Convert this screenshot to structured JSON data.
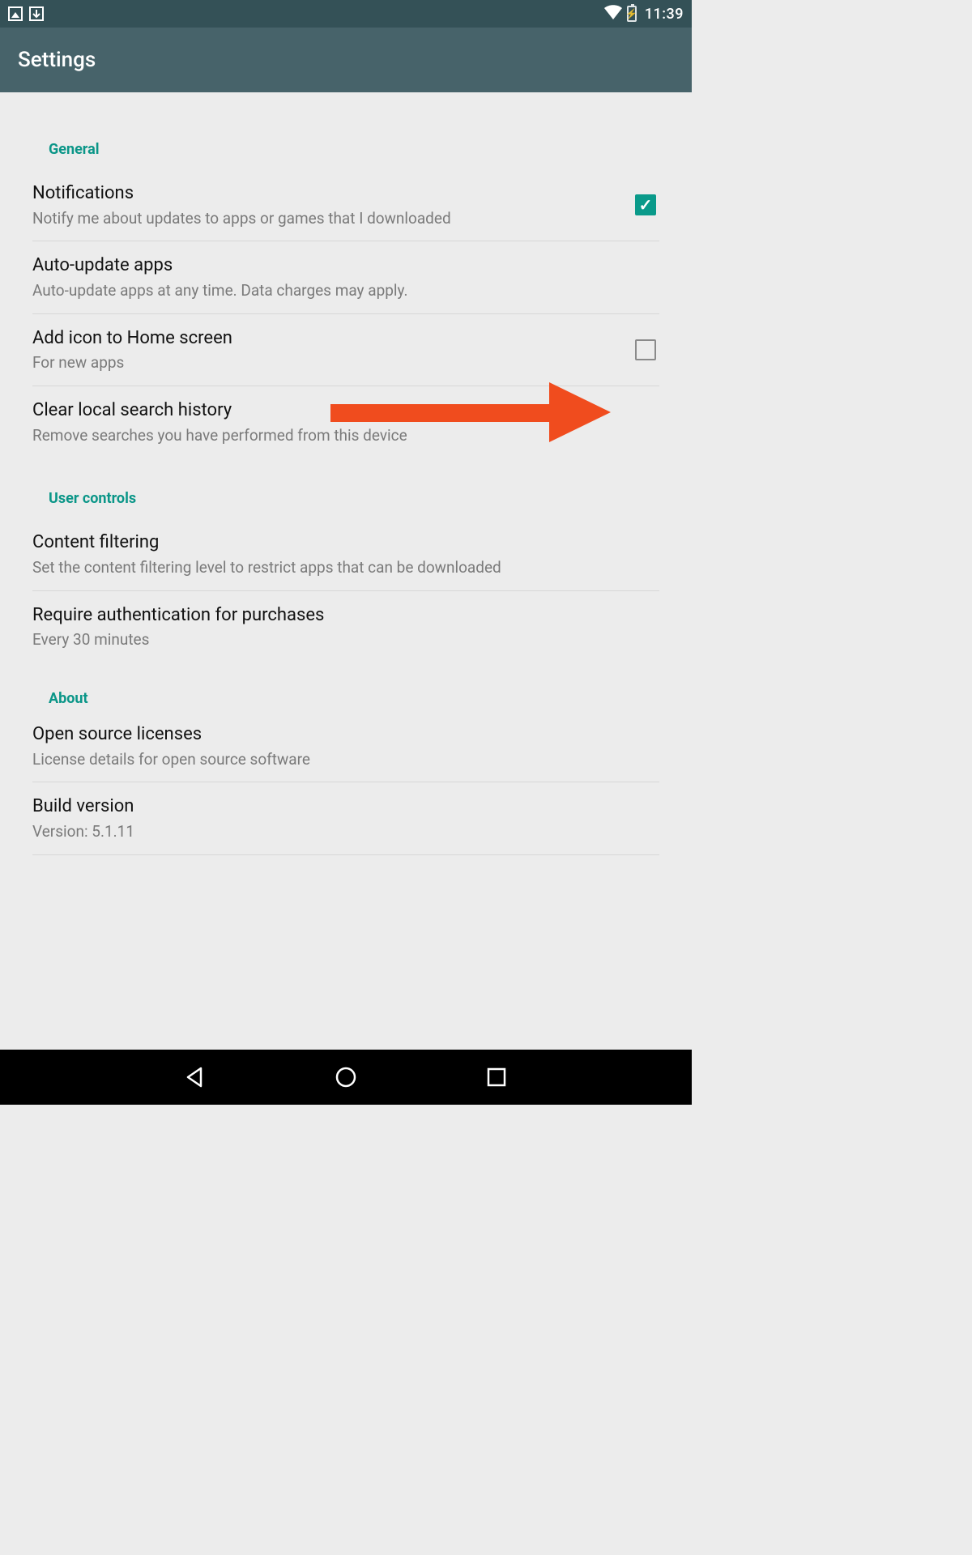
{
  "statusbar": {
    "time": "11:39"
  },
  "appbar": {
    "title": "Settings"
  },
  "sections": {
    "general": {
      "header": "General",
      "notifications": {
        "title": "Notifications",
        "sub": "Notify me about updates to apps or games that I downloaded",
        "checked": true
      },
      "auto_update": {
        "title": "Auto-update apps",
        "sub": "Auto-update apps at any time. Data charges may apply."
      },
      "add_icon": {
        "title": "Add icon to Home screen",
        "sub": "For new apps",
        "checked": false
      },
      "clear_history": {
        "title": "Clear local search history",
        "sub": "Remove searches you have performed from this device"
      }
    },
    "user_controls": {
      "header": "User controls",
      "content_filtering": {
        "title": "Content filtering",
        "sub": "Set the content filtering level to restrict apps that can be downloaded"
      },
      "require_auth": {
        "title": "Require authentication for purchases",
        "sub": "Every 30 minutes"
      }
    },
    "about": {
      "header": "About",
      "open_source": {
        "title": "Open source licenses",
        "sub": "License details for open source software"
      },
      "build_version": {
        "title": "Build version",
        "sub": "Version: 5.1.11"
      }
    }
  },
  "colors": {
    "accent": "#0b9688",
    "checkbox_fill": "#0a9a8a",
    "appbar": "#47636a",
    "statusbar": "#345157",
    "arrow": "#f04c1e"
  }
}
